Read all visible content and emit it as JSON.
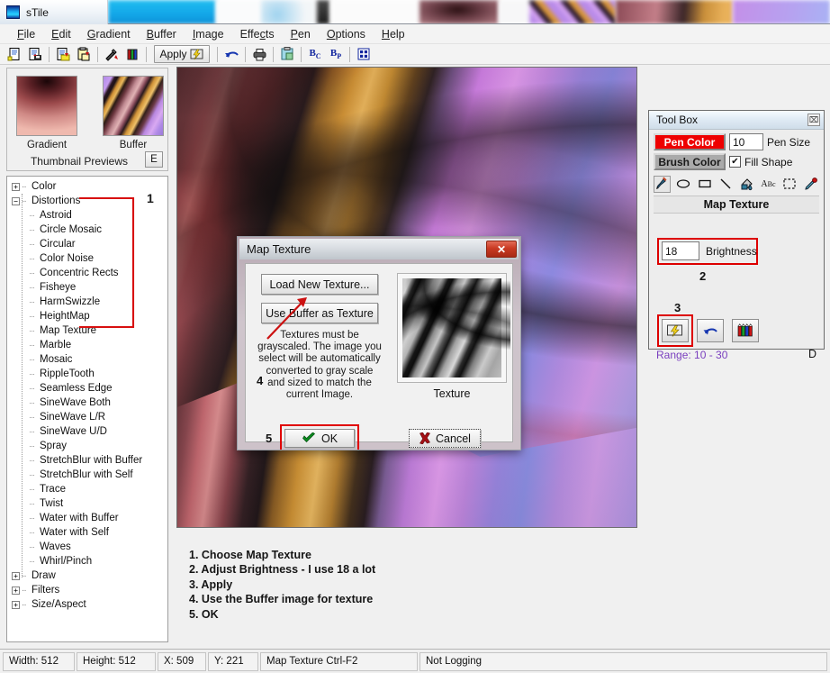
{
  "window": {
    "title": "sTile",
    "icon": "app-icon"
  },
  "menubar": {
    "items": [
      {
        "label": "File",
        "accel": "F"
      },
      {
        "label": "Edit",
        "accel": "E"
      },
      {
        "label": "Gradient",
        "accel": "G"
      },
      {
        "label": "Buffer",
        "accel": "B"
      },
      {
        "label": "Image",
        "accel": "I"
      },
      {
        "label": "Effects",
        "accel": "c"
      },
      {
        "label": "Pen",
        "accel": "P"
      },
      {
        "label": "Options",
        "accel": "O"
      },
      {
        "label": "Help",
        "accel": "H"
      }
    ]
  },
  "toolbar": {
    "apply_label": "Apply",
    "buttons": [
      {
        "name": "new-document-icon",
        "glyph": "📄"
      },
      {
        "name": "save-document-icon",
        "glyph": "💾"
      },
      {
        "name": "open-gradient-icon",
        "glyph": "📂"
      },
      {
        "name": "paste-gradient-icon",
        "glyph": "📋"
      },
      {
        "name": "tools-icon",
        "glyph": "🔧"
      },
      {
        "name": "color-bars-icon",
        "glyph": "▐"
      },
      {
        "name": "undo-icon",
        "glyph": "↶"
      },
      {
        "name": "print-icon",
        "glyph": "🖨"
      },
      {
        "name": "clipboard-icon",
        "glyph": "📋"
      },
      {
        "name": "buffer-copy-icon",
        "glyph": "Bc"
      },
      {
        "name": "buffer-paste-icon",
        "glyph": "Bp"
      },
      {
        "name": "tile-grid-icon",
        "glyph": "⊞"
      }
    ]
  },
  "left_panel": {
    "thumbnails": {
      "gradient_label": "Gradient",
      "buffer_label": "Buffer",
      "caption": "Thumbnail Previews",
      "expand_button": "E"
    },
    "tree": {
      "groups": [
        {
          "label": "Color",
          "expanded": false
        },
        {
          "label": "Distortions",
          "expanded": true
        },
        {
          "label": "Draw",
          "expanded": false
        },
        {
          "label": "Filters",
          "expanded": false
        },
        {
          "label": "Size/Aspect",
          "expanded": false
        }
      ],
      "distortions": [
        "Astroid",
        "Circle Mosaic",
        "Circular",
        "Color Noise",
        "Concentric Rects",
        "Fisheye",
        "HarmSwizzle",
        "HeightMap",
        "Map Texture",
        "Marble",
        "Mosaic",
        "RippleTooth",
        "Seamless Edge",
        "SineWave Both",
        "SineWave L/R",
        "SineWave U/D",
        "Spray",
        "StretchBlur with Buffer",
        "StretchBlur with Self",
        "Trace",
        "Twist",
        "Water with Buffer",
        "Water with Self",
        "Waves",
        "Whirl/Pinch"
      ],
      "selected": "Map Texture"
    }
  },
  "instructions": {
    "lines": [
      "1. Choose Map Texture",
      "2. Adjust Brightness - I use 18 a lot",
      "3. Apply",
      "4. Use the Buffer image for texture",
      "5. OK"
    ]
  },
  "annotations": {
    "step1": "1",
    "step2": "2",
    "step3": "3",
    "step4": "4",
    "step5": "5",
    "highlight_color": "#dd0000"
  },
  "toolbox": {
    "title": "Tool Box",
    "close_glyph": "⌧",
    "pen_color_label": "Pen Color",
    "pen_color_value": "#ee0000",
    "brush_color_label": "Brush Color",
    "brush_color_value": "#aaaaaa",
    "pen_size_value": "10",
    "pen_size_label": "Pen Size",
    "fill_shape_label": "Fill Shape",
    "fill_shape_checked": "✔",
    "tools": [
      {
        "name": "brush-tool-icon",
        "glyph": "🖌",
        "selected": true
      },
      {
        "name": "ellipse-tool-icon",
        "glyph": "⬭",
        "selected": false
      },
      {
        "name": "rectangle-tool-icon",
        "glyph": "▭",
        "selected": false
      },
      {
        "name": "line-tool-icon",
        "glyph": "╲",
        "selected": false
      },
      {
        "name": "fill-bucket-tool-icon",
        "glyph": "🪣",
        "selected": false
      },
      {
        "name": "text-tool-icon",
        "glyph": "ABc",
        "selected": false
      },
      {
        "name": "select-tool-icon",
        "glyph": "⬚",
        "selected": false
      },
      {
        "name": "eyedropper-tool-icon",
        "glyph": "✒",
        "selected": false
      }
    ],
    "effect_title": "Map Texture",
    "brightness_value": "18",
    "brightness_label": "Brightness",
    "apply_button_name": "apply-effect-button",
    "undo_button_name": "undo-effect-button",
    "colors_button_name": "color-pens-button",
    "range_text": "Range: 10 - 30",
    "dock_letter": "D"
  },
  "dialog": {
    "title": "Map Texture",
    "close_glyph": "✕",
    "load_button": "Load New Texture...",
    "buffer_button": "Use Buffer as Texture",
    "note": "Textures must be grayscaled.  The image you select will be automatically converted to gray scale and sized to match the current Image.",
    "texture_label": "Texture",
    "ok_button": "OK",
    "cancel_button": "Cancel",
    "ok_glyph": "✔",
    "cancel_glyph": "✖"
  },
  "statusbar": {
    "width": "Width: 512",
    "height": "Height: 512",
    "x": "X: 509",
    "y": "Y: 221",
    "tool": "Map Texture Ctrl-F2",
    "logging": "Not Logging"
  }
}
